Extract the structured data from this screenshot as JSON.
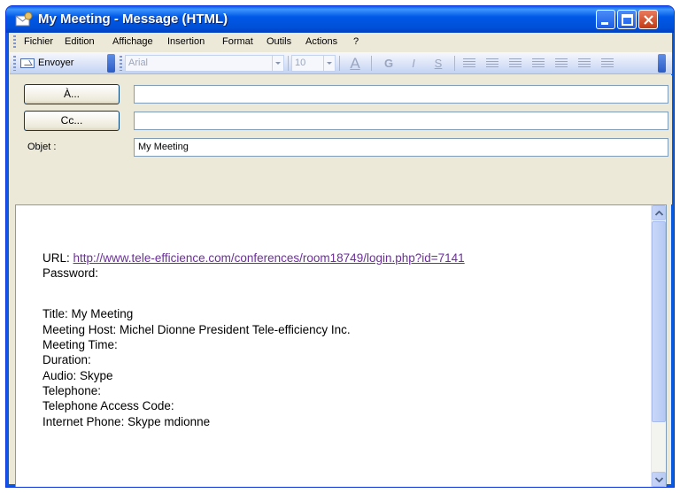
{
  "window": {
    "title": "My Meeting - Message (HTML)"
  },
  "menu": [
    "Fichier",
    "Edition",
    "Affichage",
    "Insertion",
    "Format",
    "Outils",
    "Actions",
    "?"
  ],
  "toolbar": {
    "send_label": "Envoyer",
    "font": "Arial",
    "size": "10",
    "bold": "G",
    "italic": "I",
    "underline": "S"
  },
  "form": {
    "to_button": "À...",
    "cc_button": "Cc...",
    "to_value": "",
    "cc_value": "",
    "subject_label": "Objet :",
    "subject_value": "My Meeting"
  },
  "body": {
    "url_label": "URL:",
    "url": "http://www.tele-efficience.com/conferences/room18749/login.php?id=7141",
    "lines": [
      "Password:",
      "Title: My Meeting",
      "Meeting Host: Michel Dionne President Tele-efficiency Inc.",
      "Meeting Time:",
      "Duration:",
      "Audio: Skype",
      "Telephone:",
      "Telephone Access Code:",
      "Internet Phone: Skype mdionne"
    ]
  },
  "colors": {
    "titlebar": "#0058e6",
    "link": "#6d2e9c",
    "window_bg": "#ece9d8"
  }
}
